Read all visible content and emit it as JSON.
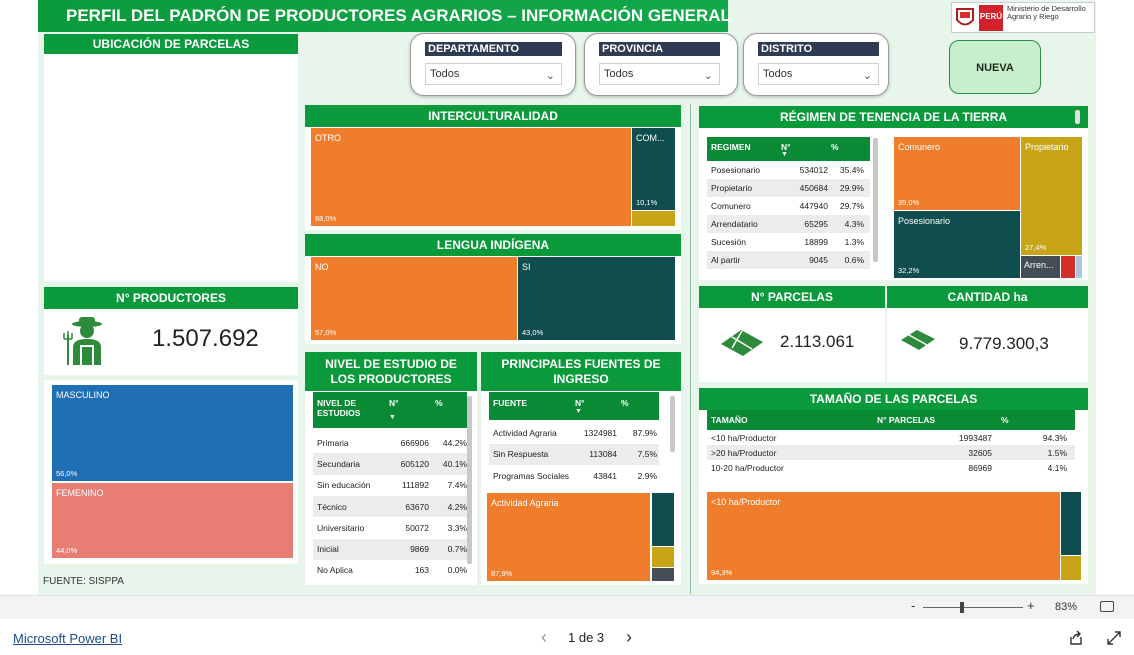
{
  "title": "PERFIL DEL PADRÓN DE PRODUCTORES AGRARIOS – INFORMACIÓN GENERAL",
  "logo": {
    "country": "PERÚ",
    "ministry": "Ministerio de Desarrollo Agrario y Riego"
  },
  "colors": {
    "green": "#0a9a3c",
    "orange": "#f07d2c",
    "teal": "#0f4d4f",
    "gold": "#c8a417",
    "blue": "#1f6fb4",
    "salmon": "#e87d74"
  },
  "filters": {
    "departamento": {
      "label": "DEPARTAMENTO",
      "value": "Todos"
    },
    "provincia": {
      "label": "PROVINCIA",
      "value": "Todos"
    },
    "distrito": {
      "label": "DISTRITO",
      "value": "Todos"
    }
  },
  "new_search_label": "NUEVA BÚSQUEDA",
  "map_title": "UBICACIÓN DE PARCELAS",
  "productores": {
    "title": "N° PRODUCTORES",
    "value": "1.507.692"
  },
  "gender": {
    "masculino": "MASCULINO",
    "masculino_pct": "56,0%",
    "femenino": "FEMENINO",
    "femenino_pct": "44,0%"
  },
  "fuente": "FUENTE: SISPPA",
  "interculturalidad": {
    "title": "INTERCULTURALIDAD",
    "otro": "OTRO",
    "otro_pct": "88,0%",
    "com": "COM...",
    "com_pct": "10,1%"
  },
  "lengua": {
    "title": "LENGUA INDÍGENA",
    "no": "NO",
    "no_pct": "57,0%",
    "si": "SI",
    "si_pct": "43,0%"
  },
  "estudio": {
    "title": "NIVEL DE ESTUDIO DE LOS PRODUCTORES",
    "headers": [
      "NIVEL DE ESTUDIOS",
      "N°",
      "%"
    ],
    "rows": [
      [
        "Primaria",
        "666906",
        "44.2%"
      ],
      [
        "Secundaria",
        "605120",
        "40.1%"
      ],
      [
        "Sin educación",
        "111892",
        "7.4%"
      ],
      [
        "Técnico",
        "63670",
        "4.2%"
      ],
      [
        "Universitario",
        "50072",
        "3.3%"
      ],
      [
        "Inicial",
        "9869",
        "0.7%"
      ],
      [
        "No Aplica",
        "163",
        "0.0%"
      ]
    ]
  },
  "fuentes_ingreso": {
    "title": "PRINCIPALES FUENTES DE INGRESO",
    "headers": [
      "FUENTE",
      "N°",
      "%"
    ],
    "rows": [
      [
        "Actividad Agraria",
        "1324981",
        "87.9%"
      ],
      [
        "Sin Respuesta",
        "113084",
        "7.5%"
      ],
      [
        "Programas Sociales",
        "43841",
        "2.9%"
      ]
    ],
    "tm_label": "Actividad Agraria",
    "tm_pct": "87,9%"
  },
  "tenencia": {
    "title": "RÉGIMEN DE TENENCIA DE LA TIERRA",
    "headers": [
      "REGIMEN",
      "N°",
      "%"
    ],
    "rows": [
      [
        "Posesionario",
        "534012",
        "35.4%"
      ],
      [
        "Propietario",
        "450684",
        "29.9%"
      ],
      [
        "Comunero",
        "447940",
        "29.7%"
      ],
      [
        "Arrendatario",
        "65295",
        "4.3%"
      ],
      [
        "Sucesión",
        "18899",
        "1.3%"
      ],
      [
        "Al partir",
        "9045",
        "0.6%"
      ]
    ],
    "tm": {
      "comunero": "Comunero",
      "comunero_pct": "35,0%",
      "propietario": "Propietario",
      "propietario_pct": "27,4%",
      "posesionario": "Posesionario",
      "posesionario_pct": "32,2%",
      "arren": "Arren..."
    }
  },
  "parcelas": {
    "title": "N° PARCELAS",
    "value": "2.113.061"
  },
  "cantidad": {
    "title": "CANTIDAD ha",
    "value": "9.779.300,3"
  },
  "tamano": {
    "title": "TAMAÑO DE LAS PARCELAS",
    "headers": [
      "TAMAÑO",
      "N° PARCELAS",
      "%"
    ],
    "rows": [
      [
        "<10 ha/Productor",
        "1993487",
        "94.3%"
      ],
      [
        ">20 ha/Productor",
        "32605",
        "1.5%"
      ],
      [
        "10-20 ha/Productor",
        "86969",
        "4.1%"
      ]
    ],
    "tm_label": "<10 ha/Productor",
    "tm_pct": "94,3%"
  },
  "footer": {
    "zoom_minus": "-",
    "zoom_plus": "+",
    "zoom": "83%",
    "brand": "Microsoft Power BI",
    "page": "1 de 3",
    "prev": "‹",
    "next": "›"
  }
}
